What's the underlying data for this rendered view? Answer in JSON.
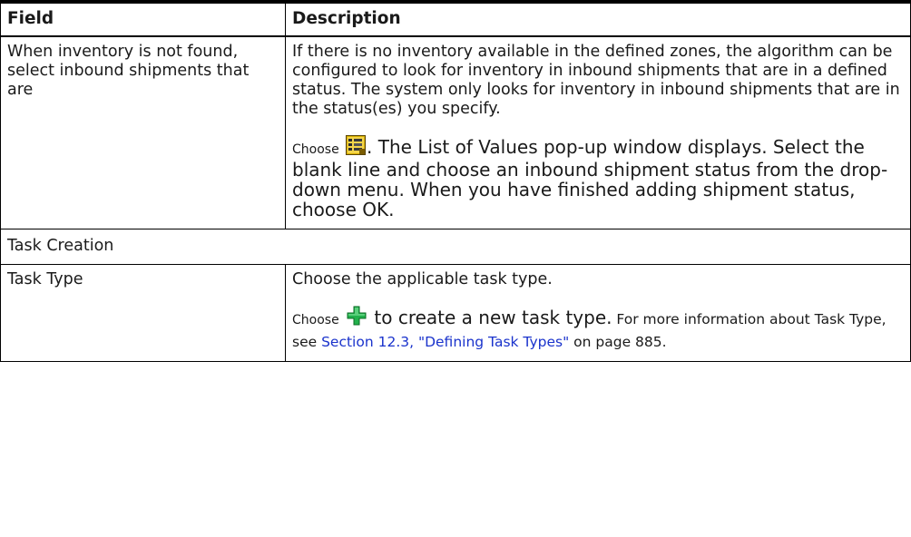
{
  "table": {
    "headers": {
      "field": "Field",
      "description": "Description"
    },
    "row1": {
      "field": "When inventory is not found, select inbound shipments that are",
      "para1": "If there is no inventory available in the defined zones, the algorithm can be configured to look for inventory in inbound shipments that are in a defined status. The system only looks for inventory in inbound shipments that are in the status(es) you specify.",
      "choose": "Choose",
      "para2_rest": ". The List of Values pop-up window displays. Select the blank line and choose an inbound shipment status from the drop-down menu. When you have finished adding shipment status, choose OK.",
      "icon": "list-of-values-icon"
    },
    "section": "Task Creation",
    "row2": {
      "field": "Task Type",
      "para1": "Choose the applicable task type.",
      "choose": "Choose",
      "para2_mid": " to create a new task type.",
      "para2_small": " For more information about Task Type, see ",
      "link": "Section 12.3, \"Defining Task Types\"",
      "page_ref": " on page 885.",
      "icon": "add-plus-icon"
    }
  },
  "colors": {
    "link": "#1a33cc",
    "plus_icon": "#22b14c",
    "border": "#000000"
  }
}
